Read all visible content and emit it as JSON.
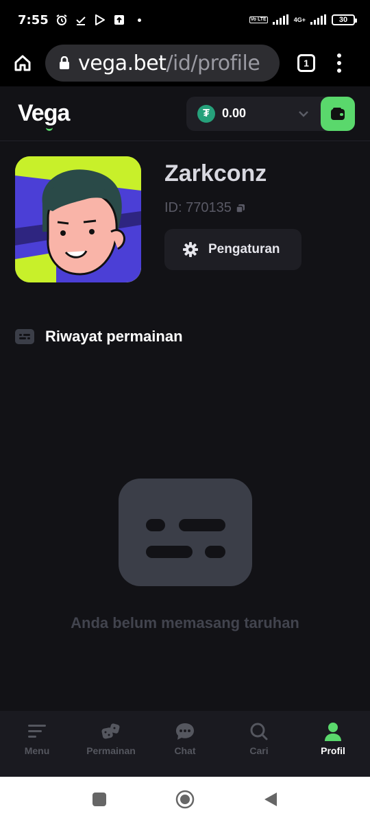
{
  "status_bar": {
    "time": "7:55",
    "volte": "Vo LTE",
    "network": "4G+",
    "battery": "30"
  },
  "browser": {
    "url_host": "vega.bet",
    "url_path": "/id/profile",
    "tab_count": "1"
  },
  "header": {
    "logo": "Vega",
    "balance": "0.00",
    "currency_icon": "tether-icon",
    "accent_color": "#5ad86c"
  },
  "profile": {
    "username": "Zarkconz",
    "id_label": "ID: 770135",
    "settings_label": "Pengaturan"
  },
  "history": {
    "title": "Riwayat permainan",
    "empty_text": "Anda belum memasang taruhan"
  },
  "bottom_nav": {
    "items": [
      {
        "label": "Menu",
        "icon": "menu-icon"
      },
      {
        "label": "Permainan",
        "icon": "dice-icon"
      },
      {
        "label": "Chat",
        "icon": "chat-icon"
      },
      {
        "label": "Cari",
        "icon": "search-icon"
      },
      {
        "label": "Profil",
        "icon": "user-icon",
        "active": true
      }
    ]
  }
}
